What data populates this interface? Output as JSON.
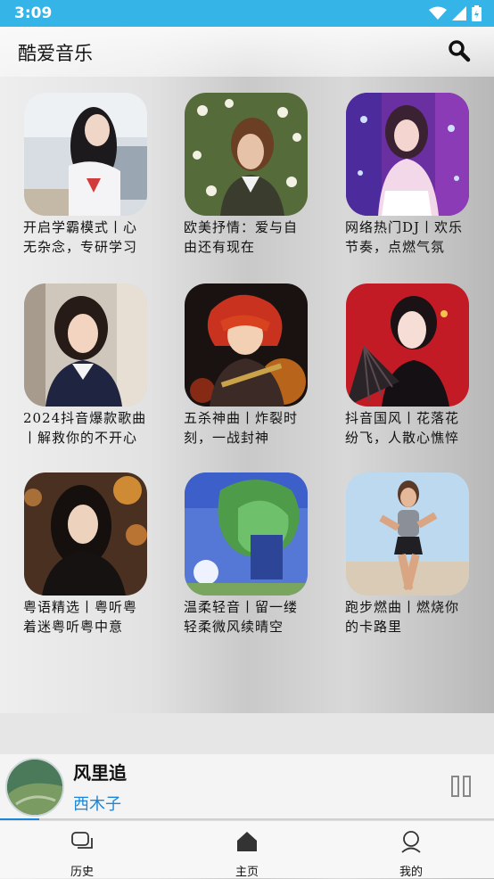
{
  "status_bar": {
    "time": "3:09"
  },
  "header": {
    "title": "酷爱音乐"
  },
  "playlists": [
    {
      "title": "开启学霸模式丨心无杂念，专研学习"
    },
    {
      "title": "欧美抒情：爱与自由还有现在"
    },
    {
      "title": "网络热门DJ丨欢乐节奏，点燃气氛"
    },
    {
      "title": "2024抖音爆款歌曲丨解救你的不开心"
    },
    {
      "title": "五杀神曲丨炸裂时刻，一战封神"
    },
    {
      "title": "抖音国风丨花落花纷飞，人散心憔悴"
    },
    {
      "title": "粤语精选丨粤听粤着迷粤听粤中意"
    },
    {
      "title": "温柔轻音丨留一缕轻柔微风续晴空"
    },
    {
      "title": "跑步燃曲丨燃烧你的卡路里"
    }
  ],
  "player": {
    "song": "风里追",
    "artist": "西木子",
    "progress": 0.08
  },
  "nav": {
    "history": "历史",
    "home": "主页",
    "mine": "我的"
  },
  "colors": {
    "status_bar": "#35b4e7",
    "accent": "#1b86d8"
  },
  "icons": [
    "wifi-icon",
    "signal-icon",
    "battery-icon",
    "search-icon",
    "pause-icon",
    "history-icon",
    "home-icon",
    "profile-icon"
  ]
}
